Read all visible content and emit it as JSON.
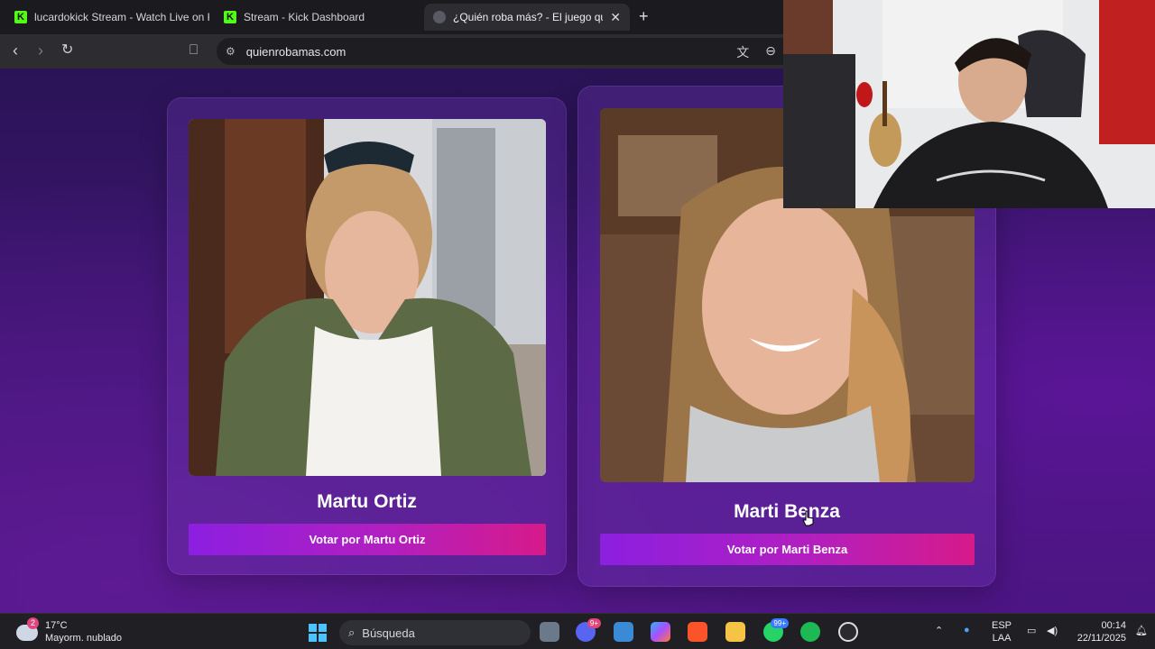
{
  "browser": {
    "tabs": [
      {
        "label": "lucardokick Stream - Watch Live on K",
        "icon": "kick-icon"
      },
      {
        "label": "Stream - Kick Dashboard",
        "icon": "kick-icon"
      },
      {
        "label": "¿Quién roba más? - El juego que",
        "icon": "game-icon",
        "active": true
      }
    ],
    "url": "quienrobamas.com"
  },
  "candidates": [
    {
      "name": "Martu Ortiz",
      "vote_label": "Votar por Martu Ortiz"
    },
    {
      "name": "Marti Benza",
      "vote_label": "Votar por Marti Benza"
    }
  ],
  "taskbar": {
    "weather": {
      "temp": "17°C",
      "desc": "Mayorm. nublado",
      "badge": "2"
    },
    "search_placeholder": "Búsqueda",
    "discord_badge": "9+",
    "whatsapp_badge": "99+",
    "lang_line1": "ESP",
    "lang_line2": "LAA",
    "time": "00:14",
    "date": "22/11/2025"
  },
  "colors": {
    "vote_gradient_start": "#8c1fe0",
    "vote_gradient_end": "#d61a8a",
    "kick_green": "#53fc18"
  }
}
